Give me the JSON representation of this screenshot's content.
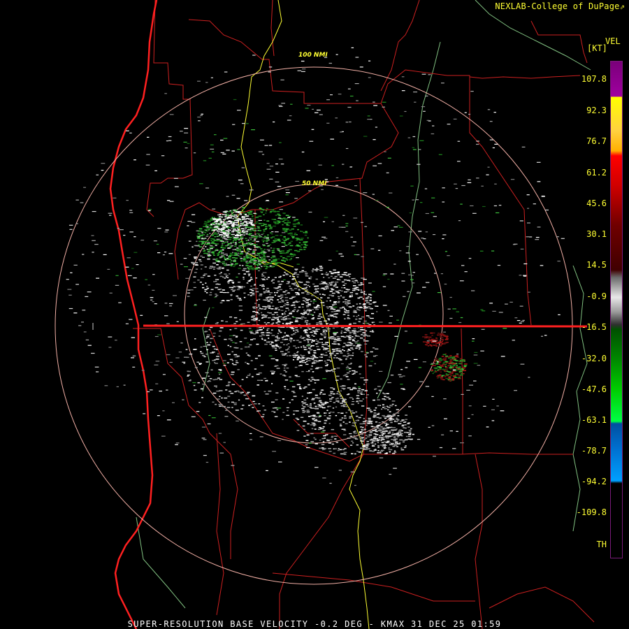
{
  "credit": "NEXLAB-College of DuPage",
  "credit_icon": "external-link-icon",
  "legend": {
    "title": "VEL",
    "unit": "[KT]",
    "labels": [
      "107.8",
      "92.3",
      "76.7",
      "61.2",
      "45.6",
      "30.1",
      "14.5",
      "-0.9",
      "-16.5",
      "-32.0",
      "-47.6",
      "-63.1",
      "-78.7",
      "-94.2",
      "-109.8",
      "TH"
    ],
    "colors": {
      "label_text": "#ffff33",
      "purple": "#7a007a",
      "yellow": "#ffff00",
      "red": "#ff0000",
      "gray": "#e8e8e8",
      "green": "#00cc00",
      "blue": "#00a0ff"
    }
  },
  "rings": {
    "inner_label": "50 NMI",
    "outer_label": "100 NMI",
    "color": "#f3b0a6"
  },
  "caption": "SUPER-RESOLUTION BASE VELOCITY -0.2 DEG - KMAX 31 DEC 25 01:59",
  "map_colors": {
    "coast": "#ff2020",
    "county": "#cc2020",
    "highway": "#ffff33",
    "river": "#80c080"
  }
}
